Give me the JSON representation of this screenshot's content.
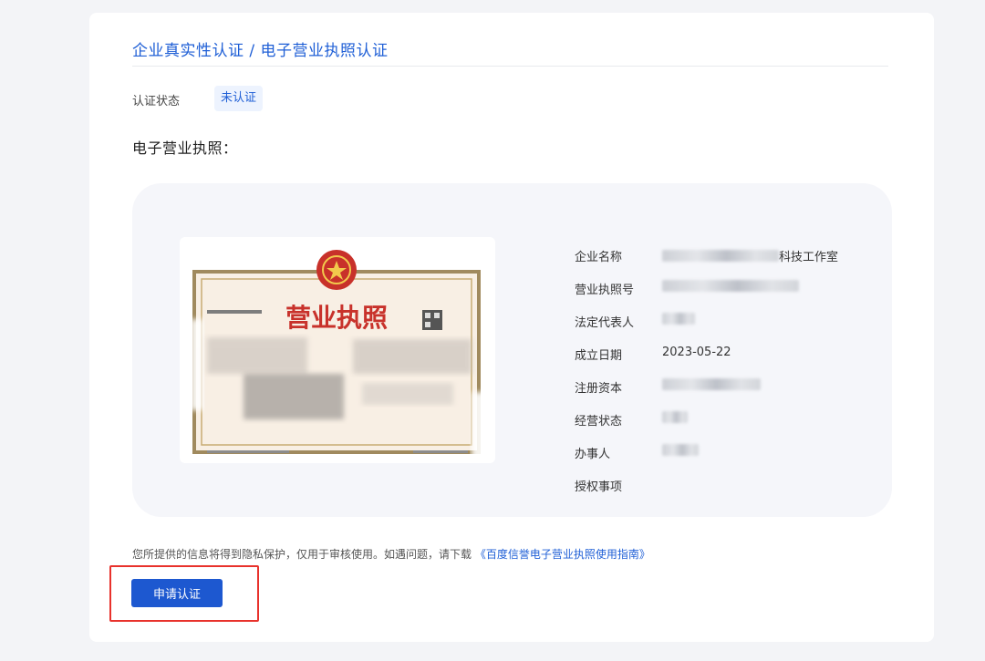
{
  "breadcrumb": "企业真实性认证 / 电子营业执照认证",
  "status": {
    "label": "认证状态",
    "value": "未认证"
  },
  "section_title": "电子营业执照：",
  "license_image": {
    "title": "营业执照"
  },
  "fields": [
    {
      "label": "企业名称",
      "value": "科技工作室"
    },
    {
      "label": "营业执照号",
      "value": ""
    },
    {
      "label": "法定代表人",
      "value": ""
    },
    {
      "label": "成立日期",
      "value": "2023-05-22"
    },
    {
      "label": "注册资本",
      "value": ""
    },
    {
      "label": "经营状态",
      "value": ""
    },
    {
      "label": "办事人",
      "value": ""
    },
    {
      "label": "授权事项",
      "value": ""
    }
  ],
  "privacy": {
    "text": "您所提供的信息将得到隐私保护，仅用于审核使用。如遇问题，请下载",
    "link": "《百度信誉电子营业执照使用指南》"
  },
  "apply_button": "申请认证",
  "colors": {
    "accent": "#1d58d0",
    "highlight": "#e8322c"
  }
}
